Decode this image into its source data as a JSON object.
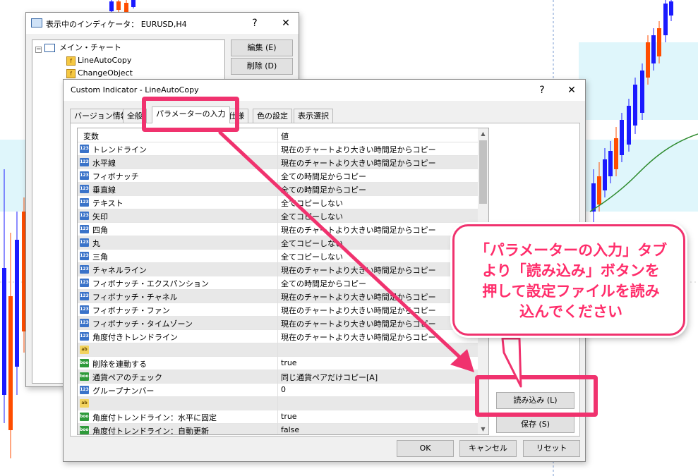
{
  "back_window": {
    "title": "表示中のインディケータ： EURUSD,H4",
    "help": "?",
    "close": "✕",
    "tree": {
      "root": "メイン・チャート",
      "items": [
        "LineAutoCopy",
        "ChangeObject"
      ]
    },
    "edit_button": "編集 (E)",
    "delete_button": "削除 (D)"
  },
  "dialog": {
    "title": "Custom Indicator - LineAutoCopy",
    "help": "?",
    "close": "✕",
    "tabs": [
      "バージョン情報",
      "全般",
      "パラメーターの入力",
      "仕様",
      "色の設定",
      "表示選択"
    ],
    "grid": {
      "col_variable": "変数",
      "col_value": "値",
      "rows": [
        {
          "icon": "123",
          "name": "トレンドライン",
          "value": "現在のチャートより大きい時間足からコピー"
        },
        {
          "icon": "123",
          "name": "水平線",
          "value": "現在のチャートより大きい時間足からコピー"
        },
        {
          "icon": "123",
          "name": "フィボナッチ",
          "value": "全ての時間足からコピー"
        },
        {
          "icon": "123",
          "name": "垂直線",
          "value": "全ての時間足からコピー"
        },
        {
          "icon": "123",
          "name": "テキスト",
          "value": "全てコピーしない"
        },
        {
          "icon": "123",
          "name": "矢印",
          "value": "全てコピーしない"
        },
        {
          "icon": "123",
          "name": "四角",
          "value": "現在のチャートより大きい時間足からコピー"
        },
        {
          "icon": "123",
          "name": "丸",
          "value": "全てコピーしない"
        },
        {
          "icon": "123",
          "name": "三角",
          "value": "全てコピーしない"
        },
        {
          "icon": "123",
          "name": "チャネルライン",
          "value": "現在のチャートより大きい時間足からコピー"
        },
        {
          "icon": "123",
          "name": "フィボナッチ・エクスパンション",
          "value": "全ての時間足からコピー"
        },
        {
          "icon": "123",
          "name": "フィボナッチ・チャネル",
          "value": "現在のチャートより大きい時間足からコピー"
        },
        {
          "icon": "123",
          "name": "フィボナッチ・ファン",
          "value": "現在のチャートより大きい時間足からコピー"
        },
        {
          "icon": "123",
          "name": "フィボナッチ・タイムゾーン",
          "value": "現在のチャートより大きい時間足からコピー"
        },
        {
          "icon": "123",
          "name": "角度付きトレンドライン",
          "value": "現在のチャートより大きい時間足からコピー"
        },
        {
          "icon": "ab",
          "name": "",
          "value": ""
        },
        {
          "icon": "bool",
          "name": "削除を連動する",
          "value": "true"
        },
        {
          "icon": "bool",
          "name": "通貨ペアのチェック",
          "value": "同じ通貨ペアだけコピー[A]"
        },
        {
          "icon": "123",
          "name": "グループナンバー",
          "value": "0"
        },
        {
          "icon": "ab",
          "name": "",
          "value": ""
        },
        {
          "icon": "bool",
          "name": "角度付トレンドライン：水平に固定",
          "value": "true"
        },
        {
          "icon": "bool",
          "name": "角度付トレンドライン：自動更新",
          "value": "false"
        }
      ]
    },
    "load_button": "読み込み (L)",
    "save_button": "保存 (S)",
    "ok_button": "OK",
    "cancel_button": "キャンセル",
    "reset_button": "リセット"
  },
  "callout": {
    "lines": [
      "「パラメーターの入力」タブ",
      "より「読み込み」ボタンを",
      "押して設定ファイルを読み",
      "込んでください"
    ]
  },
  "colors": {
    "accent": "#f0326e",
    "callout_text": "#ff2d6b",
    "bull": "#1a1aff",
    "bear": "#ff4d00",
    "ma_line": "#2e8b2e",
    "zone": "#dff6fb"
  }
}
